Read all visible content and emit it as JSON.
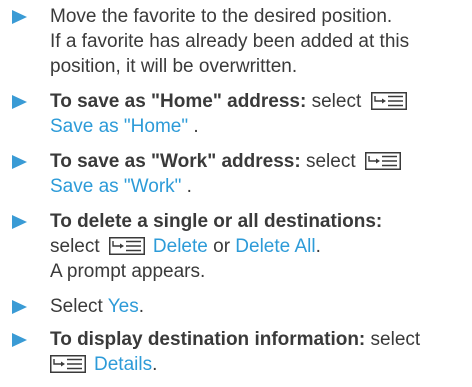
{
  "steps": [
    {
      "line1": "Move the favorite to the desired position.",
      "line2": "If a favorite has already been added at this",
      "line3": "position, it will be overwritten."
    },
    {
      "bold": "To save as \"Home\" address:",
      "text": " select",
      "option": "Save as \"Home\"",
      "after": " ."
    },
    {
      "bold": "To save as \"Work\" address:",
      "text": " select",
      "option": "Save as \"Work\"",
      "after": " ."
    },
    {
      "bold": "To delete a single or all destinations:",
      "text_before": "select",
      "option1": "Delete",
      "or": " or ",
      "option2": "Delete All",
      "after": ".",
      "line3": "A prompt appears."
    },
    {
      "text": "Select ",
      "option": "Yes",
      "after": "."
    },
    {
      "bold": "To display destination information:",
      "text": " select",
      "option": "Details",
      "after": "."
    }
  ],
  "icons": {
    "menu": "menu-icon",
    "bullet": "arrow-bullet-icon"
  },
  "colors": {
    "ui_text": "#2d9bd8",
    "bullet": "#3a9bd5",
    "body_text": "#3a3a3a"
  }
}
